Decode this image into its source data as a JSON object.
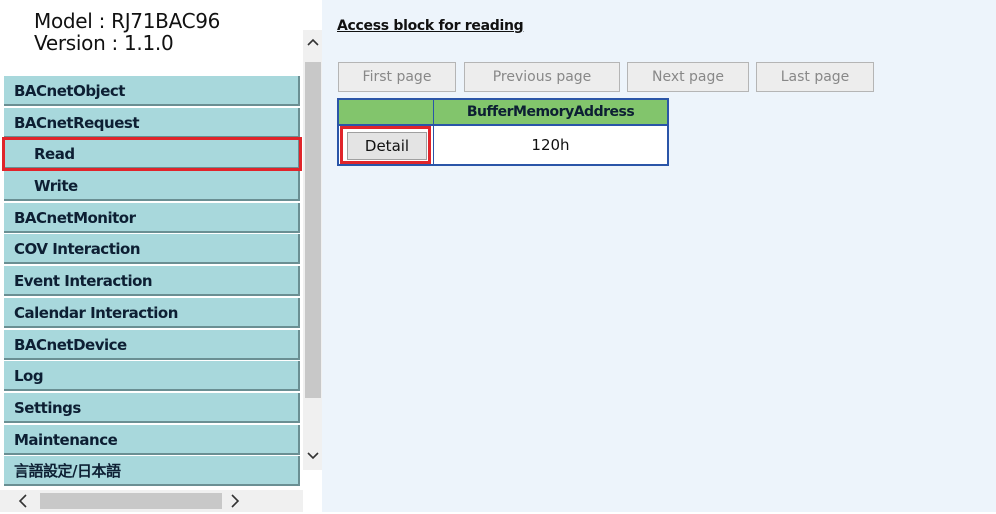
{
  "sidebar": {
    "model_line": "Model : RJ71BAC96",
    "version_line": "Version : 1.1.0",
    "items": [
      {
        "label": "BACnetObject"
      },
      {
        "label": "BACnetRequest"
      },
      {
        "label": "Read",
        "selected": true
      },
      {
        "label": "Write"
      },
      {
        "label": "BACnetMonitor"
      },
      {
        "label": "COV Interaction"
      },
      {
        "label": "Event Interaction"
      },
      {
        "label": "Calendar Interaction"
      },
      {
        "label": "BACnetDevice"
      },
      {
        "label": "Log"
      },
      {
        "label": "Settings"
      },
      {
        "label": "Maintenance"
      },
      {
        "label": "言語設定/日本語"
      }
    ],
    "scroll_up_icon": "chevron-up-icon",
    "scroll_down_icon": "chevron-down-icon",
    "scroll_left_icon": "chevron-left-icon",
    "scroll_right_icon": "chevron-right-icon"
  },
  "main": {
    "heading": "Access block for reading",
    "pager": {
      "first": "First page",
      "previous": "Previous page",
      "next": "Next page",
      "last": "Last page"
    },
    "table": {
      "header": "BufferMemoryAddress",
      "rows": [
        {
          "button": "Detail",
          "address": "120h"
        }
      ]
    }
  },
  "colors": {
    "nav_bg": "#a8d8dc",
    "table_header_bg": "#82c56c",
    "table_border": "#2a55a8",
    "highlight": "#e0242a",
    "main_bg": "#edf4fb"
  }
}
